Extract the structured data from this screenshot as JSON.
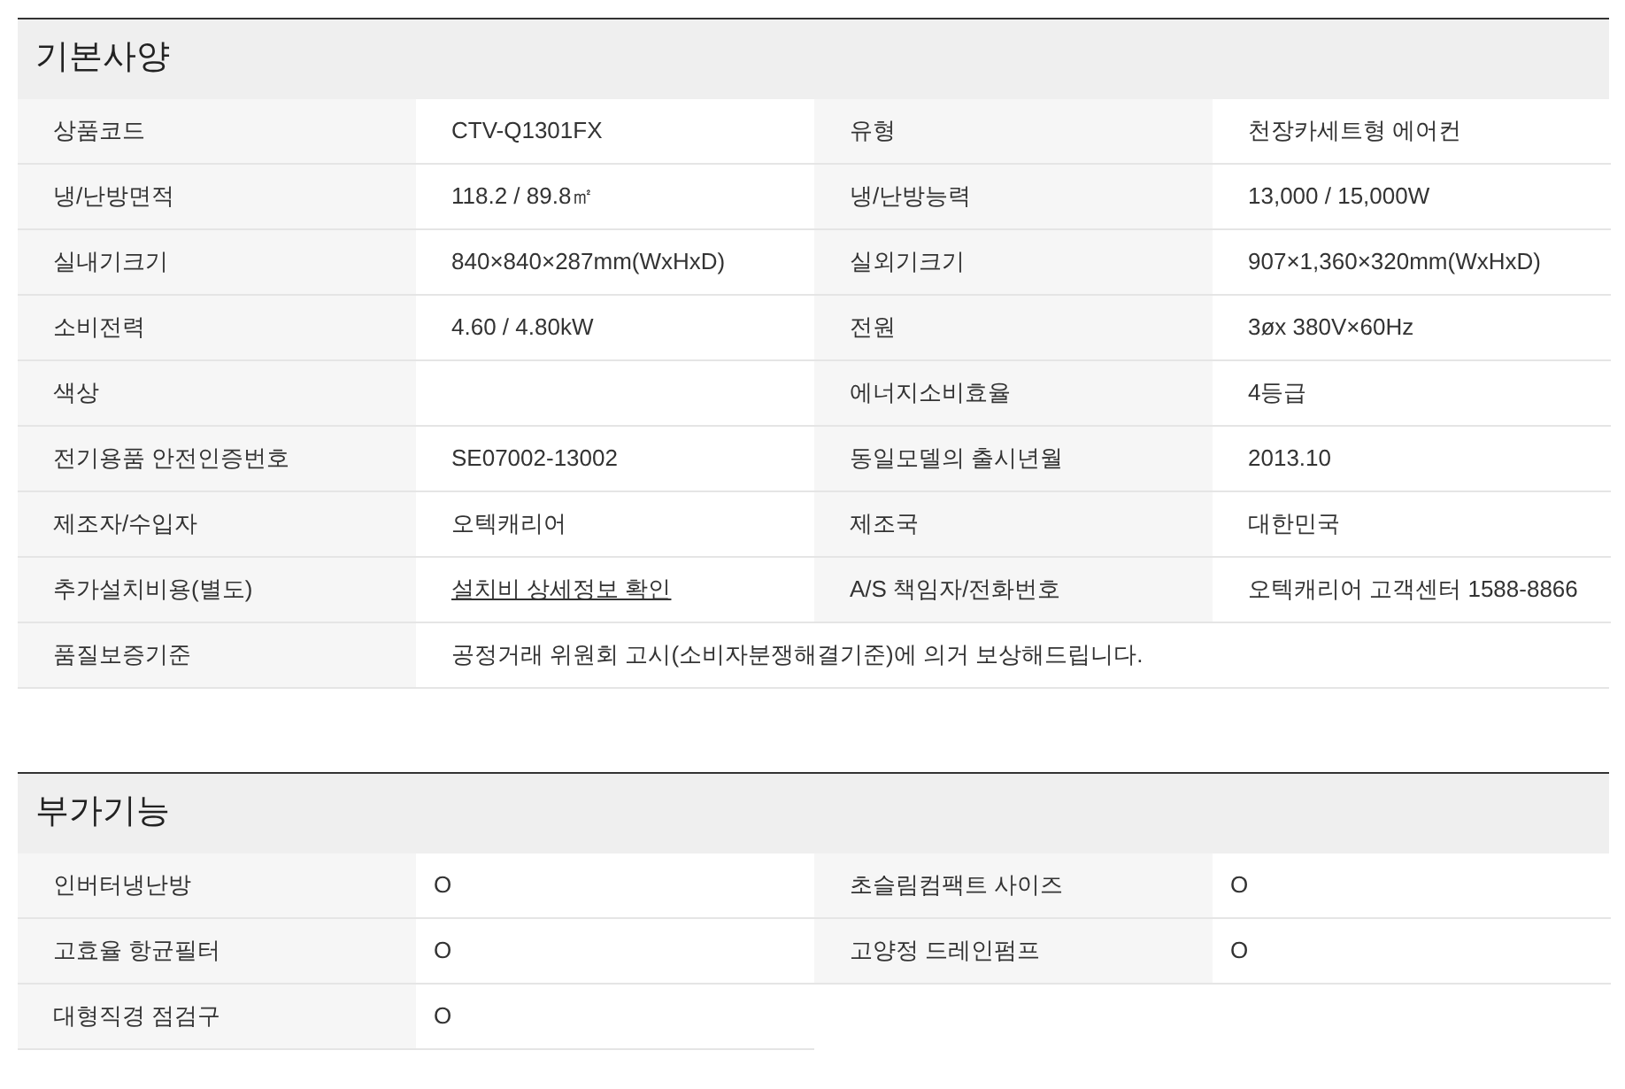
{
  "sections": [
    {
      "title": "기본사양",
      "kind": "specs",
      "rows": [
        {
          "kind": "pair",
          "cells": [
            {
              "label": "상품코드",
              "value": "CTV-Q1301FX"
            },
            {
              "label": "유형",
              "value": "천장카세트형 에어컨"
            }
          ]
        },
        {
          "kind": "pair",
          "cells": [
            {
              "label": "냉/난방면적",
              "value": "118.2 / 89.8㎡"
            },
            {
              "label": "냉/난방능력",
              "value": "13,000 / 15,000W"
            }
          ]
        },
        {
          "kind": "pair",
          "cells": [
            {
              "label": "실내기크기",
              "value": "840×840×287mm(WxHxD)"
            },
            {
              "label": "실외기크기",
              "value": "907×1,360×320mm(WxHxD)"
            }
          ]
        },
        {
          "kind": "pair",
          "cells": [
            {
              "label": "소비전력",
              "value": "4.60 / 4.80kW"
            },
            {
              "label": "전원",
              "value": "3øx 380V×60Hz"
            }
          ]
        },
        {
          "kind": "pair",
          "cells": [
            {
              "label": "색상"
            },
            {
              "label": "에너지소비효율",
              "value": "4등급"
            }
          ]
        },
        {
          "kind": "pair",
          "cells": [
            {
              "label": "전기용품 안전인증번호",
              "value": "SE07002-13002"
            },
            {
              "label": "동일모델의 출시년월",
              "value": "2013.10"
            }
          ]
        },
        {
          "kind": "pair",
          "cells": [
            {
              "label": "제조자/수입자",
              "value": "오텍캐리어"
            },
            {
              "label": "제조국",
              "value": "대한민국"
            }
          ]
        },
        {
          "kind": "pair",
          "cells": [
            {
              "label": "추가설치비용(별도)",
              "value": "설치비 상세정보 확인",
              "kind": "link"
            },
            {
              "label": "A/S 책임자/전화번호",
              "value": "오텍캐리어 고객센터 1588-8866"
            }
          ]
        },
        {
          "kind": "wide",
          "cells": [
            {
              "label": "품질보증기준",
              "value": "공정거래 위원회 고시(소비자분쟁해결기준)에 의거 보상해드립니다."
            }
          ]
        }
      ]
    },
    {
      "title": "부가기능",
      "kind": "features",
      "rows": [
        {
          "kind": "pair",
          "cells": [
            {
              "label": "인버터냉난방",
              "value": "O"
            },
            {
              "label": "초슬림컴팩트 사이즈",
              "value": "O"
            }
          ]
        },
        {
          "kind": "pair",
          "cells": [
            {
              "label": "고효율 항균필터",
              "value": "O"
            },
            {
              "label": "고양정 드레인펌프",
              "value": "O"
            }
          ]
        },
        {
          "kind": "pair",
          "cells": [
            {
              "label": "대형직경 점검구",
              "value": "O"
            }
          ]
        }
      ]
    }
  ]
}
